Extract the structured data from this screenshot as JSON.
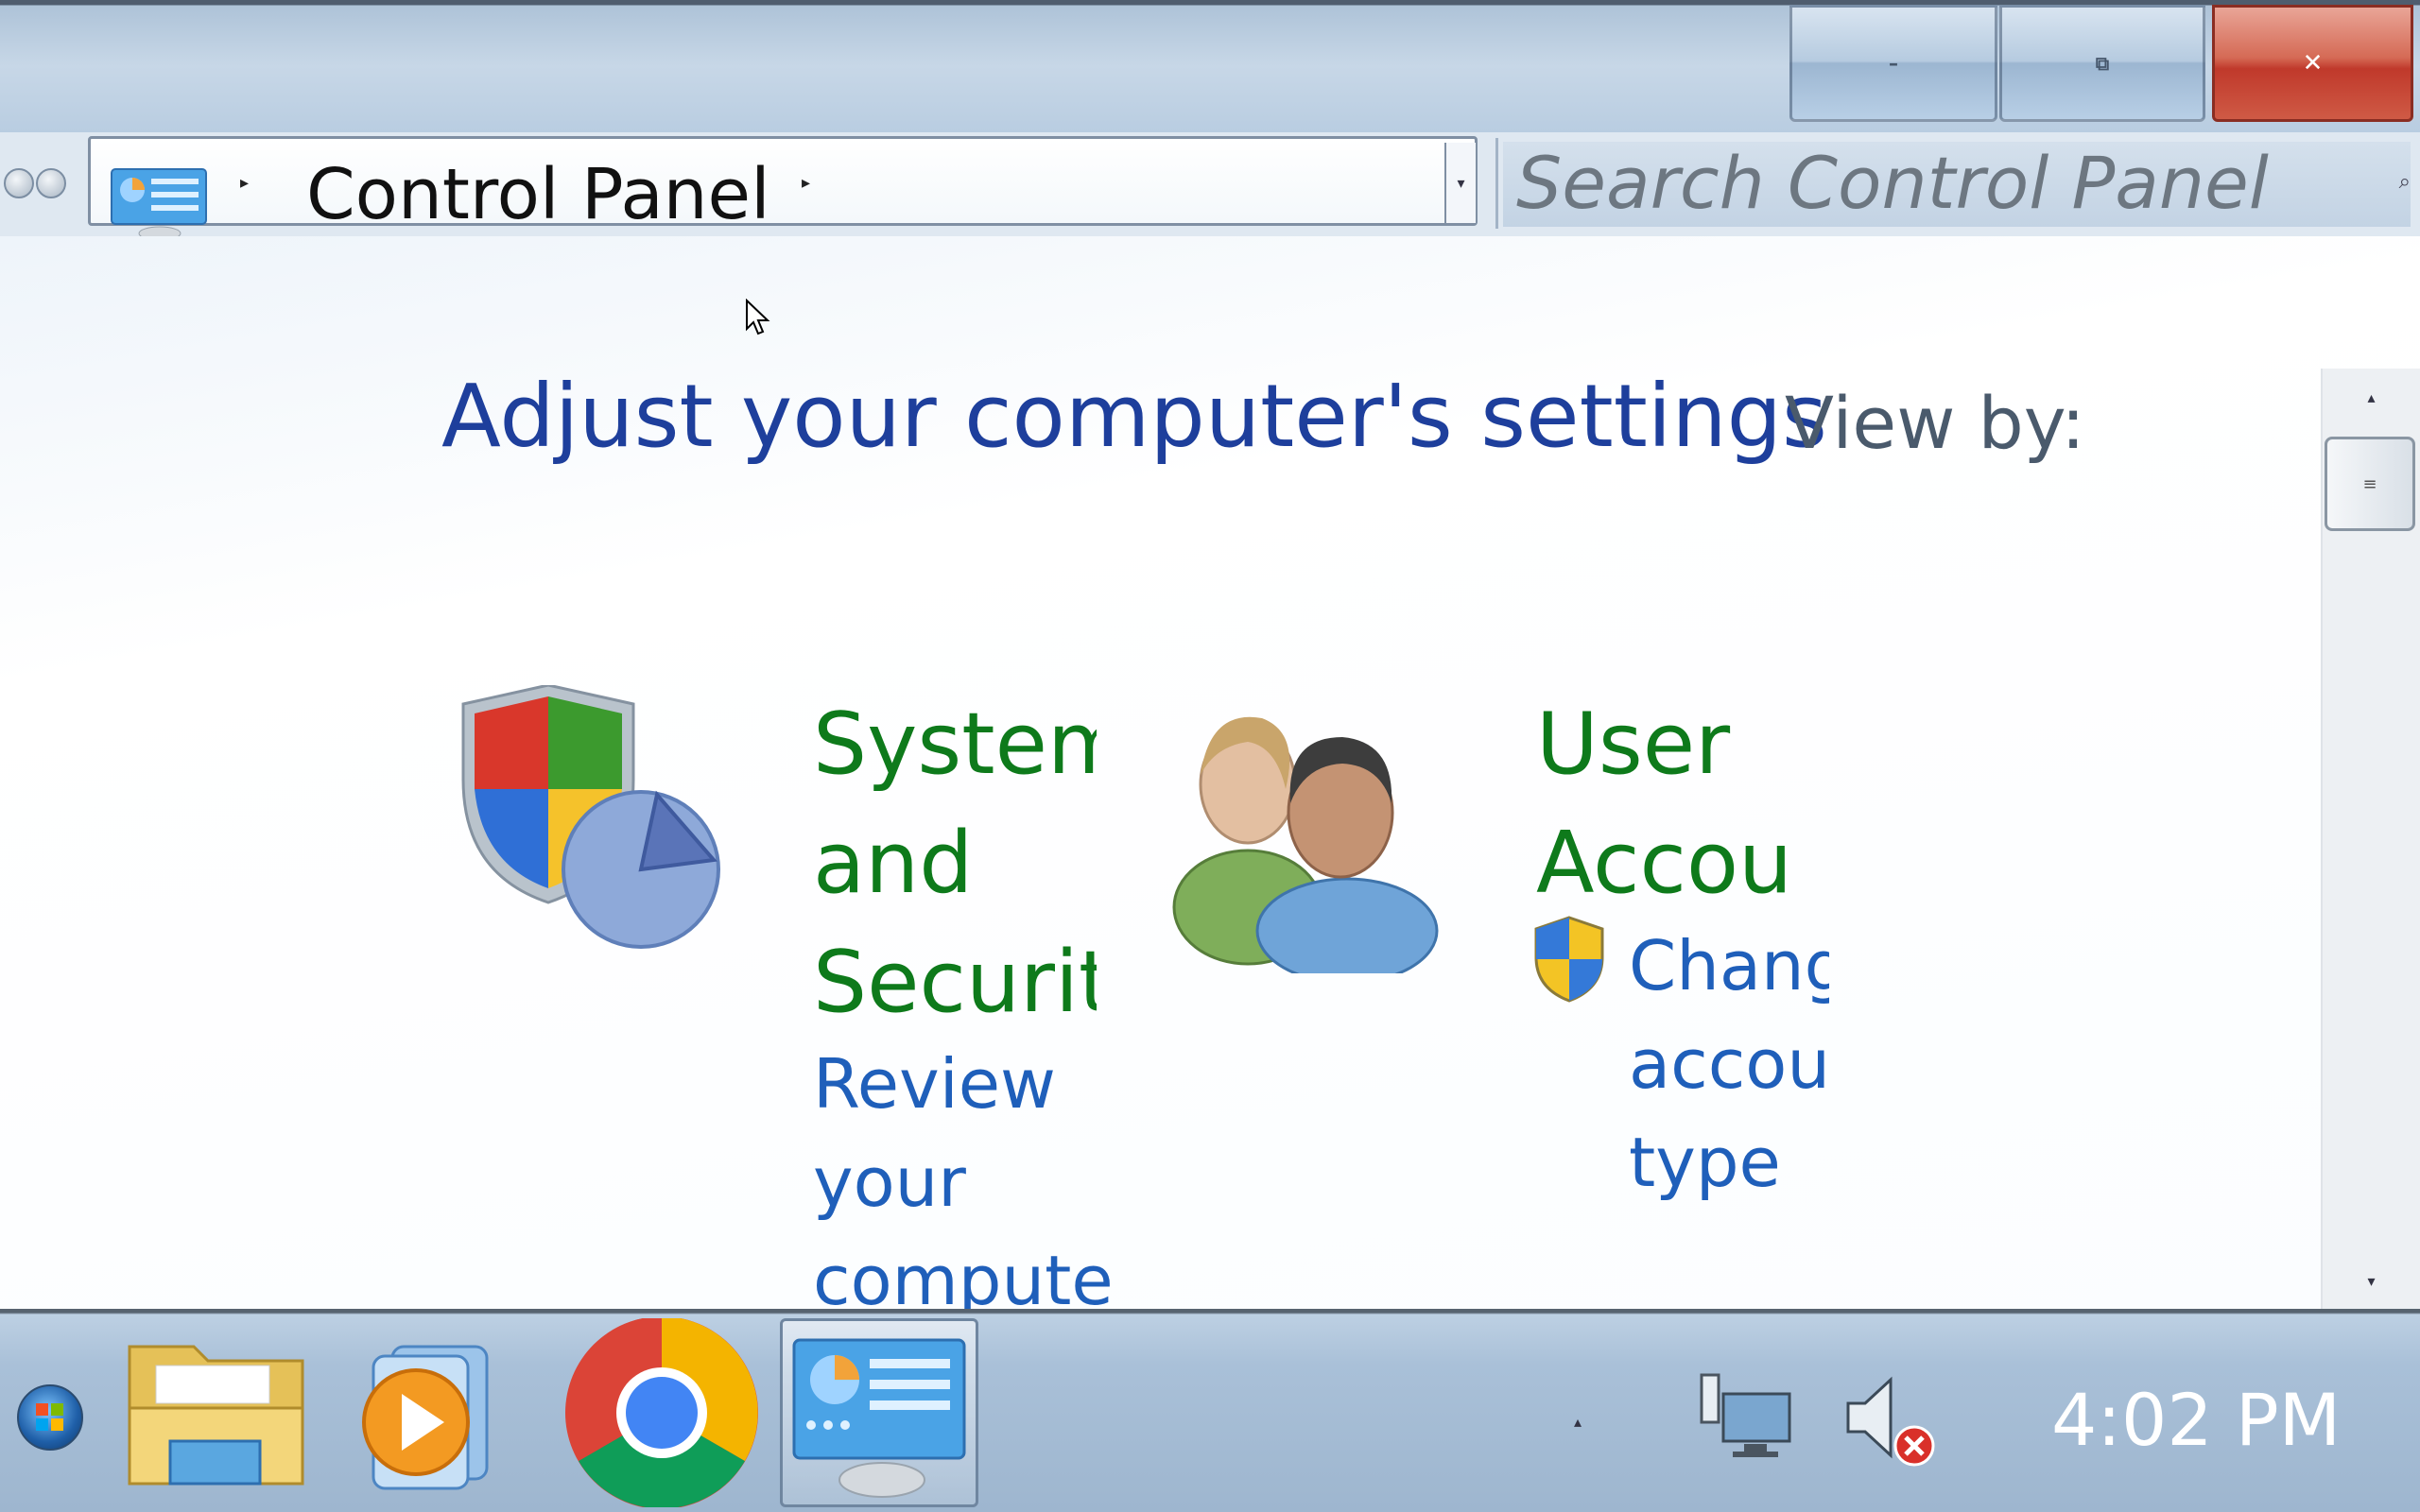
{
  "window": {
    "caption": {
      "minimize_glyph": "–",
      "restore_glyph": "⧉",
      "close_glyph": "✕"
    }
  },
  "address_bar": {
    "breadcrumb": [
      "Control Panel"
    ],
    "icon": "control-panel-icon"
  },
  "search": {
    "placeholder": "Search Control Panel",
    "icon": "magnifier-icon"
  },
  "content": {
    "title": "Adjust your computer's settings",
    "view_by_label": "View by:",
    "categories": [
      {
        "icon": "shield-pie-chart-icon",
        "heading_lines": [
          "System",
          "and",
          "Security"
        ],
        "links": [
          {
            "lines": [
              "Review",
              "your",
              "computer"
            ]
          }
        ]
      },
      {
        "icon": "users-icon",
        "heading_lines": [
          "User",
          "Accounts"
        ],
        "links": [
          {
            "icon": "uac-shield-icon",
            "lines": [
              "Change",
              "account",
              "type"
            ]
          }
        ]
      }
    ]
  },
  "taskbar": {
    "pinned": [
      {
        "name": "windows-explorer",
        "icon": "folder-icon"
      },
      {
        "name": "windows-media-player",
        "icon": "media-player-icon"
      },
      {
        "name": "google-chrome",
        "icon": "chrome-icon"
      },
      {
        "name": "control-panel",
        "icon": "control-panel-icon",
        "active": true
      }
    ],
    "tray": {
      "network_icon": "network-icon",
      "volume_icon": "volume-muted-icon",
      "clock": "4:02 PM"
    }
  },
  "colors": {
    "title_blue": "#1e3f9c",
    "category_green": "#0e7a1b",
    "link_blue": "#1f5fba",
    "close_red": "#c0392b"
  }
}
